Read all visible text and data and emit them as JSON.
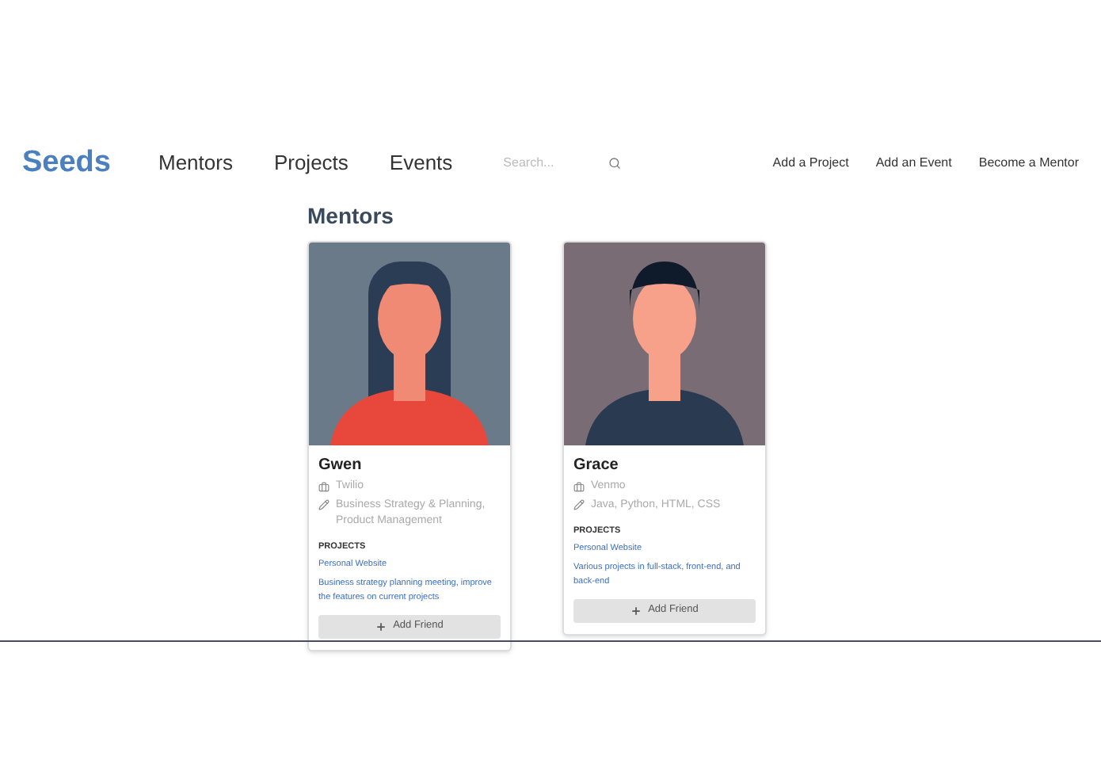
{
  "nav": {
    "brand": "Seeds",
    "links": [
      "Mentors",
      "Projects",
      "Events"
    ],
    "search": {
      "placeholder": "Search..."
    },
    "actions": [
      "Add a Project",
      "Add an Event",
      "Become a Mentor"
    ]
  },
  "heading": "Mentors",
  "mentors": [
    {
      "name": "Gwen",
      "company": "Twilio",
      "skills": "Business Strategy & Planning, Product Management",
      "projects_label": "PROJECTS",
      "projects": [
        "Personal Website",
        "Business strategy planning meeting, improve the features on current projects"
      ],
      "button": "Add Friend"
    },
    {
      "name": "Grace",
      "company": "Venmo",
      "skills": "Java, Python, HTML, CSS",
      "projects_label": "PROJECTS",
      "projects": [
        "Personal Website",
        "Various projects in full-stack, front-end, and back-end"
      ],
      "button": "Add Friend"
    }
  ]
}
